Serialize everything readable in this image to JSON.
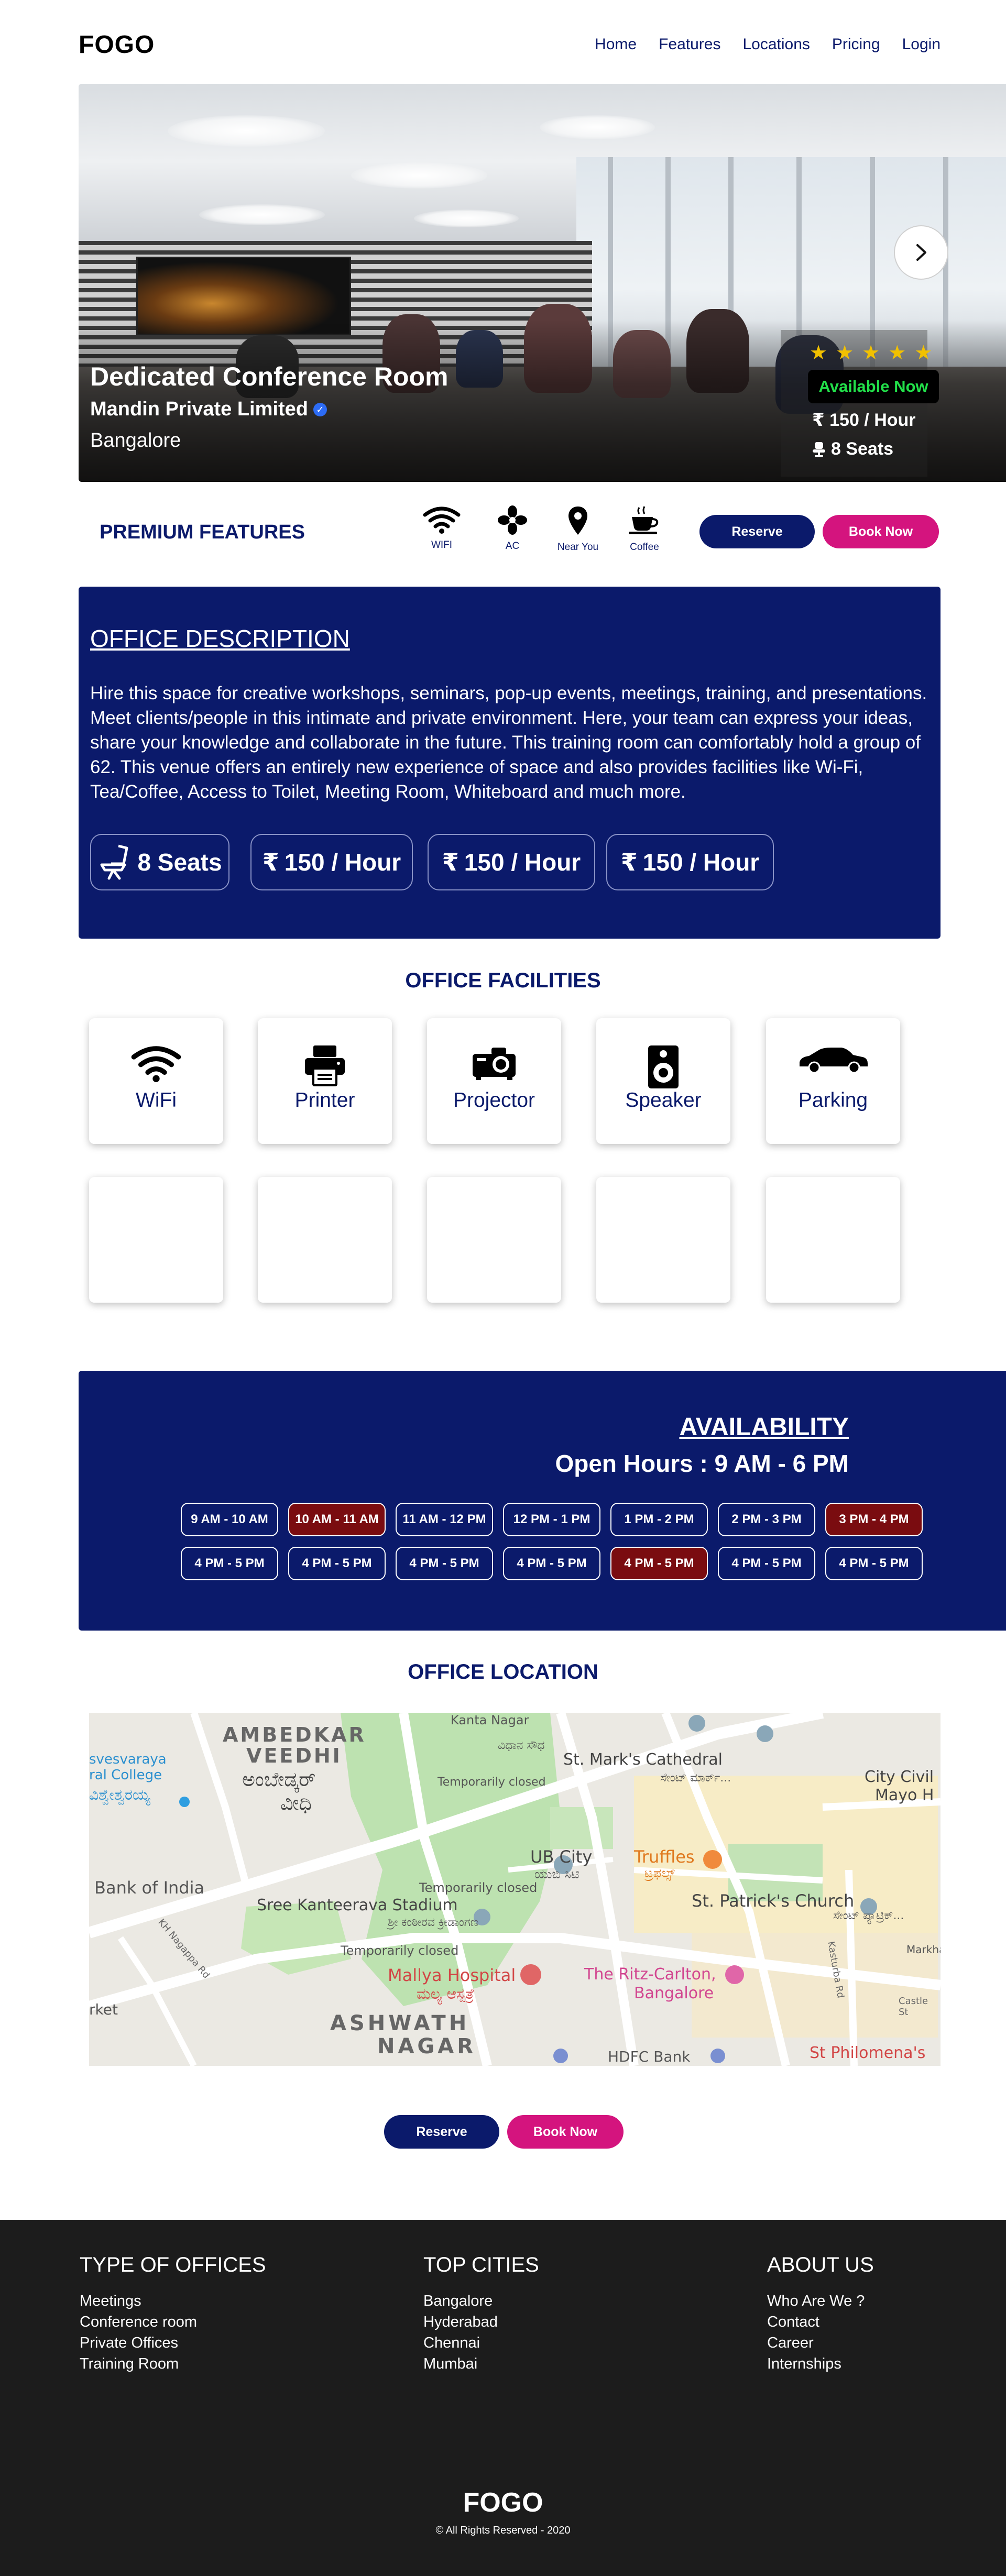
{
  "nav": {
    "logo": "FOGO",
    "links": [
      "Home",
      "Features",
      "Locations",
      "Pricing",
      "Login"
    ]
  },
  "hero": {
    "title": "Dedicated Conference Room",
    "company": "Mandin Private Limited",
    "city": "Bangalore",
    "rating": 5,
    "availability": "Available Now",
    "price": "150 / Hour",
    "seats": "8 Seats",
    "next_icon": "chevron-right-icon"
  },
  "premium": {
    "title": "PREMIUM FEATURES",
    "features": [
      {
        "label": "WIFI",
        "icon": "wifi-icon"
      },
      {
        "label": "AC",
        "icon": "fan-icon"
      },
      {
        "label": "Near You",
        "icon": "location-pin-icon"
      },
      {
        "label": "Coffee",
        "icon": "coffee-icon"
      }
    ],
    "reserve": "Reserve",
    "book_now": "Book Now"
  },
  "description": {
    "title": "OFFICE DESCRIPTION",
    "text": "Hire this space for creative workshops, seminars, pop-up events, meetings, training, and presentations. Meet clients/people in this intimate and private environment. Here, your team can express your ideas, share your knowledge and collaborate in the future. This training room can comfortably hold a group of 62. This venue offers an entirely new experience of space and also provides facilities like Wi-Fi, Tea/Coffee, Access to Toilet, Meeting Room, Whiteboard and much more.",
    "pills": [
      "8 Seats",
      "150 / Hour",
      "150 / Hour",
      "150 / Hour"
    ],
    "currency_symbol": "₹"
  },
  "facilities": {
    "title": "OFFICE FACILITIES",
    "items": [
      {
        "label": "WiFi",
        "icon": "wifi-icon"
      },
      {
        "label": "Printer",
        "icon": "printer-icon"
      },
      {
        "label": "Projector",
        "icon": "projector-icon"
      },
      {
        "label": "Speaker",
        "icon": "speaker-icon"
      },
      {
        "label": "Parking",
        "icon": "car-icon"
      }
    ]
  },
  "availability": {
    "title": "AVAILABILITY",
    "hours": "Open Hours : 9 AM - 6 PM",
    "row1": [
      {
        "label": "9 AM - 10 AM",
        "booked": false
      },
      {
        "label": "10 AM - 11 AM",
        "booked": true
      },
      {
        "label": "11 AM - 12 PM",
        "booked": false
      },
      {
        "label": "12 PM - 1 PM",
        "booked": false
      },
      {
        "label": "1 PM - 2 PM",
        "booked": false
      },
      {
        "label": "2 PM - 3 PM",
        "booked": false
      },
      {
        "label": "3 PM - 4 PM",
        "booked": true
      }
    ],
    "row2": [
      {
        "label": "4 PM - 5 PM",
        "booked": false
      },
      {
        "label": "4 PM - 5 PM",
        "booked": false
      },
      {
        "label": "4 PM - 5 PM",
        "booked": false
      },
      {
        "label": "4 PM - 5 PM",
        "booked": false
      },
      {
        "label": "4 PM - 5 PM",
        "booked": true
      },
      {
        "label": "4 PM - 5 PM",
        "booked": false
      },
      {
        "label": "4 PM - 5 PM",
        "booked": false
      }
    ]
  },
  "location": {
    "title": "OFFICE LOCATION",
    "map_labels": {
      "ambedkar": "AMBEDKAR",
      "veedhi": "VEEDHI",
      "ambedkar_kn": "ಅಂಬೇಡ್ಕರ್",
      "veedhi_kn": "ವೀಧಿ",
      "kanta_nagar": "Kanta Nagar",
      "vidhana": "ವಿಧಾನ ಸೌಧ",
      "temporarily_closed_1": "Temporarily closed",
      "college": "svesvaraya",
      "college2": "ral College",
      "college_kn": "ವಿಶ್ವೇಶ್ವರಯ್ಯ",
      "stmarks": "St. Mark's Cathedral",
      "stmarks_kn": "ಸೇಂಟ್ ಮಾರ್ಕ್...",
      "city_civil": "City Civil",
      "mayo": "Mayo H",
      "bank_india": "Bank of India",
      "ub_city": "UB City",
      "ub_city_kn": "ಯುಬಿ ಸಿಟಿ",
      "temporarily_closed_2": "Temporarily closed",
      "truffles": "Truffles",
      "truffles_kn": "ಟ್ರಫಲ್ಸ್",
      "kanteerava": "Sree Kanteerava Stadium",
      "kanteerava_kn": "ಶ್ರೀ ಕಂಠೀರವ ಕ್ರೀಡಾಂಗಣ",
      "temporarily_closed_3": "Temporarily closed",
      "stpatricks": "St. Patrick's Church",
      "stpatricks_kn": "ಸೇಂಟ್ ಪ್ಯಾಟ್ರಿಕ್...",
      "mallya": "Mallya Hospital",
      "mallya_kn": "ಮಲ್ಯ ಆಸ್ಪತ್ರೆ",
      "ritz": "The Ritz-Carlton,",
      "ritz2": "Bangalore",
      "ashwath": "ASHWATH",
      "nagar": "NAGAR",
      "hdfc": "HDFC Bank",
      "philomena": "St Philomena's",
      "kasturba": "Kasturba Rd",
      "nagappa": "KH Nagappa Rd",
      "market": "rket",
      "markha": "Markha",
      "castle": "Castle St"
    },
    "reserve": "Reserve",
    "book_now": "Book Now"
  },
  "footer": {
    "columns": [
      {
        "title": "TYPE OF OFFICES",
        "items": [
          "Meetings",
          "Conference room",
          "Private Offices",
          "Training Room"
        ]
      },
      {
        "title": "TOP CITIES",
        "items": [
          "Bangalore",
          "Hyderabad",
          "Chennai",
          "Mumbai"
        ]
      },
      {
        "title": "ABOUT US",
        "items": [
          "Who Are We ?",
          "Contact",
          "Career",
          "Internships"
        ]
      }
    ],
    "logo": "FOGO",
    "copyright": "© All Rights Reserved - 2020"
  },
  "colors": {
    "navy": "#0b1a6b",
    "pink": "#d4147e",
    "booked": "#7a0c10",
    "available_green": "#22e04a",
    "footer_bg": "#1c1c1c"
  }
}
